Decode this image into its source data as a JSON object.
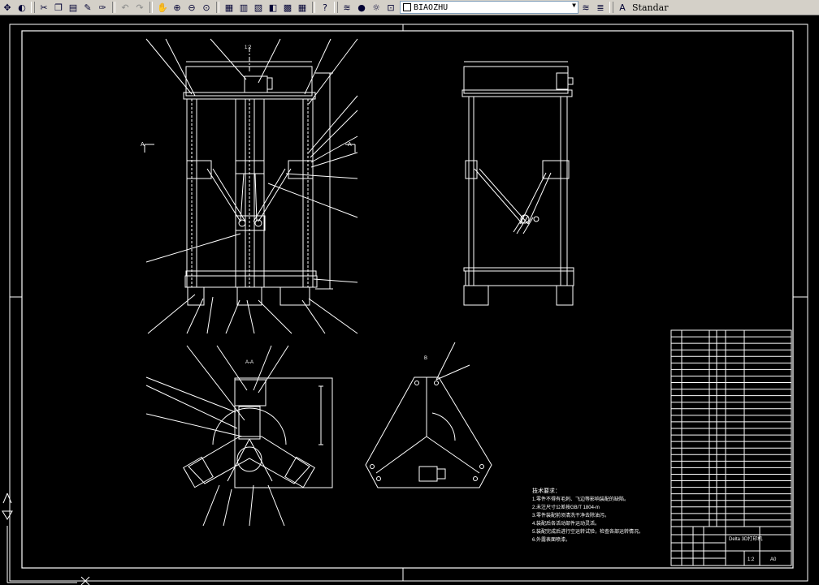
{
  "toolbar": {
    "icons": [
      "pan-realtime-icon",
      "pan-icon",
      "cut-icon",
      "copy-icon",
      "paste-icon",
      "match-properties-icon",
      "block-edit-icon",
      "undo-icon",
      "redo-icon",
      "zoom-realtime-icon",
      "zoom-window-icon",
      "zoom-previous-icon",
      "zoom-extents-icon",
      "properties-icon",
      "design-center-icon",
      "tool-palettes-icon",
      "sheet-set-icon",
      "markup-icon",
      "calculator-icon",
      "help-icon",
      "layer-manager-icon",
      "layer-on-icon",
      "layer-freeze-icon",
      "layer-lock-icon",
      "layer-color-icon",
      "layer-previous-icon",
      "make-current-icon",
      "text-style-icon"
    ],
    "layer_name": "BIAOZHU",
    "text_style": "Standar"
  },
  "drawing": {
    "main_title": "Delta 3D打印机",
    "scale": "1:2",
    "sheet": "A0",
    "section_label": "A-A",
    "view_labels": [
      "A",
      "A",
      "B"
    ],
    "tech_requirements_title": "技术要求：",
    "tech_requirements": [
      "1.零件不得有毛刺、飞边等影响装配的缺陷。",
      "2.未注尺寸公差按GB/T 1804-m",
      "3.零件装配前须清洗干净去除油污。",
      "4.装配后各活动部件运动灵活。",
      "5.装配完成后进行空运转试验，检查各部运转情况。",
      "6.外露表面喷漆。"
    ],
    "bom_count": 30,
    "colors": {
      "background": "#000000",
      "lines": "#ffffff",
      "toolbar": "#d4d0c8"
    }
  }
}
